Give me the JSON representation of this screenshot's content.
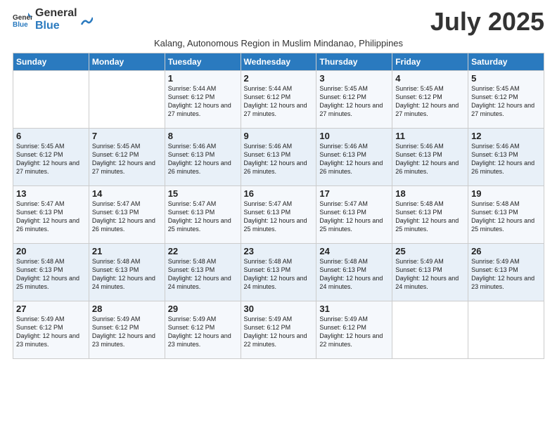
{
  "logo": {
    "text_general": "General",
    "text_blue": "Blue"
  },
  "title": "July 2025",
  "subtitle": "Kalang, Autonomous Region in Muslim Mindanao, Philippines",
  "days_of_week": [
    "Sunday",
    "Monday",
    "Tuesday",
    "Wednesday",
    "Thursday",
    "Friday",
    "Saturday"
  ],
  "weeks": [
    [
      {
        "day": "",
        "info": ""
      },
      {
        "day": "",
        "info": ""
      },
      {
        "day": "1",
        "info": "Sunrise: 5:44 AM\nSunset: 6:12 PM\nDaylight: 12 hours and 27 minutes."
      },
      {
        "day": "2",
        "info": "Sunrise: 5:44 AM\nSunset: 6:12 PM\nDaylight: 12 hours and 27 minutes."
      },
      {
        "day": "3",
        "info": "Sunrise: 5:45 AM\nSunset: 6:12 PM\nDaylight: 12 hours and 27 minutes."
      },
      {
        "day": "4",
        "info": "Sunrise: 5:45 AM\nSunset: 6:12 PM\nDaylight: 12 hours and 27 minutes."
      },
      {
        "day": "5",
        "info": "Sunrise: 5:45 AM\nSunset: 6:12 PM\nDaylight: 12 hours and 27 minutes."
      }
    ],
    [
      {
        "day": "6",
        "info": "Sunrise: 5:45 AM\nSunset: 6:12 PM\nDaylight: 12 hours and 27 minutes."
      },
      {
        "day": "7",
        "info": "Sunrise: 5:45 AM\nSunset: 6:12 PM\nDaylight: 12 hours and 27 minutes."
      },
      {
        "day": "8",
        "info": "Sunrise: 5:46 AM\nSunset: 6:13 PM\nDaylight: 12 hours and 26 minutes."
      },
      {
        "day": "9",
        "info": "Sunrise: 5:46 AM\nSunset: 6:13 PM\nDaylight: 12 hours and 26 minutes."
      },
      {
        "day": "10",
        "info": "Sunrise: 5:46 AM\nSunset: 6:13 PM\nDaylight: 12 hours and 26 minutes."
      },
      {
        "day": "11",
        "info": "Sunrise: 5:46 AM\nSunset: 6:13 PM\nDaylight: 12 hours and 26 minutes."
      },
      {
        "day": "12",
        "info": "Sunrise: 5:46 AM\nSunset: 6:13 PM\nDaylight: 12 hours and 26 minutes."
      }
    ],
    [
      {
        "day": "13",
        "info": "Sunrise: 5:47 AM\nSunset: 6:13 PM\nDaylight: 12 hours and 26 minutes."
      },
      {
        "day": "14",
        "info": "Sunrise: 5:47 AM\nSunset: 6:13 PM\nDaylight: 12 hours and 26 minutes."
      },
      {
        "day": "15",
        "info": "Sunrise: 5:47 AM\nSunset: 6:13 PM\nDaylight: 12 hours and 25 minutes."
      },
      {
        "day": "16",
        "info": "Sunrise: 5:47 AM\nSunset: 6:13 PM\nDaylight: 12 hours and 25 minutes."
      },
      {
        "day": "17",
        "info": "Sunrise: 5:47 AM\nSunset: 6:13 PM\nDaylight: 12 hours and 25 minutes."
      },
      {
        "day": "18",
        "info": "Sunrise: 5:48 AM\nSunset: 6:13 PM\nDaylight: 12 hours and 25 minutes."
      },
      {
        "day": "19",
        "info": "Sunrise: 5:48 AM\nSunset: 6:13 PM\nDaylight: 12 hours and 25 minutes."
      }
    ],
    [
      {
        "day": "20",
        "info": "Sunrise: 5:48 AM\nSunset: 6:13 PM\nDaylight: 12 hours and 25 minutes."
      },
      {
        "day": "21",
        "info": "Sunrise: 5:48 AM\nSunset: 6:13 PM\nDaylight: 12 hours and 24 minutes."
      },
      {
        "day": "22",
        "info": "Sunrise: 5:48 AM\nSunset: 6:13 PM\nDaylight: 12 hours and 24 minutes."
      },
      {
        "day": "23",
        "info": "Sunrise: 5:48 AM\nSunset: 6:13 PM\nDaylight: 12 hours and 24 minutes."
      },
      {
        "day": "24",
        "info": "Sunrise: 5:48 AM\nSunset: 6:13 PM\nDaylight: 12 hours and 24 minutes."
      },
      {
        "day": "25",
        "info": "Sunrise: 5:49 AM\nSunset: 6:13 PM\nDaylight: 12 hours and 24 minutes."
      },
      {
        "day": "26",
        "info": "Sunrise: 5:49 AM\nSunset: 6:13 PM\nDaylight: 12 hours and 23 minutes."
      }
    ],
    [
      {
        "day": "27",
        "info": "Sunrise: 5:49 AM\nSunset: 6:12 PM\nDaylight: 12 hours and 23 minutes."
      },
      {
        "day": "28",
        "info": "Sunrise: 5:49 AM\nSunset: 6:12 PM\nDaylight: 12 hours and 23 minutes."
      },
      {
        "day": "29",
        "info": "Sunrise: 5:49 AM\nSunset: 6:12 PM\nDaylight: 12 hours and 23 minutes."
      },
      {
        "day": "30",
        "info": "Sunrise: 5:49 AM\nSunset: 6:12 PM\nDaylight: 12 hours and 22 minutes."
      },
      {
        "day": "31",
        "info": "Sunrise: 5:49 AM\nSunset: 6:12 PM\nDaylight: 12 hours and 22 minutes."
      },
      {
        "day": "",
        "info": ""
      },
      {
        "day": "",
        "info": ""
      }
    ]
  ]
}
